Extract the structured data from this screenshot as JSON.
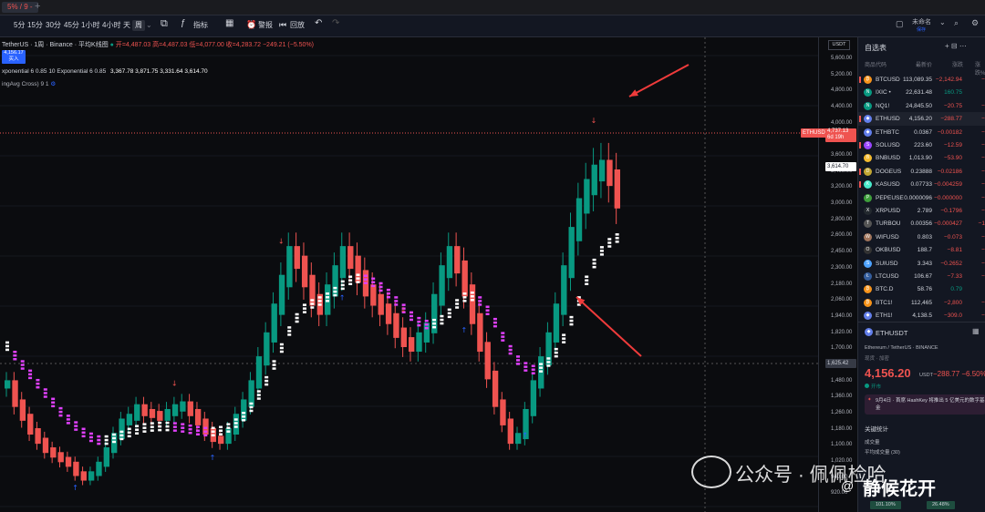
{
  "topbar": {
    "tab_label": "5% / 9 -",
    "plus": "+"
  },
  "toolbar": {
    "intervals": [
      "5分",
      "15分",
      "30分",
      "45分",
      "1小时",
      "4小时",
      "天",
      "周"
    ],
    "active_interval": "周",
    "indicators_label": "指标",
    "alert_label": "警报",
    "replay_label": "回放",
    "unnamed_label": "未命名",
    "save_sub": "保存"
  },
  "chart_header": {
    "symbol_line": "TetherUS · 1周 · Binance · 平均K线图",
    "ohlc": "开=4,487.03  高=4,487.03  低=4,077.00  收=4,283.72  −249.21 (−5.50%)",
    "price_box": "4,156.17",
    "price_box_sub": "买入",
    "indicator_line": "xponential 6 0.85 10 Exponential 6 0.85",
    "indicator_values": "3,367.78  3,871.75  3,331.64  3,614.70",
    "indicator2": "ingAvg Cross) 9 1"
  },
  "axis": {
    "unit": "USDT",
    "ticks": [
      "5,600.00",
      "5,200.00",
      "4,800.00",
      "4,400.00",
      "4,000.00",
      "3,800.00",
      "3,600.00",
      "3,400.00",
      "3,200.00",
      "3,000.00",
      "2,800.00",
      "2,600.00",
      "2,450.00",
      "2,300.00",
      "2,180.00",
      "2,060.00",
      "1,940.00",
      "1,820.00",
      "1,700.00",
      "1,580.00",
      "1,480.00",
      "1,360.00",
      "1,260.00",
      "1,180.00",
      "1,100.00",
      "1,020.00",
      "940.00",
      "920.00"
    ],
    "label_ethusdt": "ETHUSDT",
    "label_last": "4,737.13",
    "label_last_sub": "6d 19h",
    "label_ema": "3,614.70",
    "label_cross": "1,625.42"
  },
  "chart_data": {
    "type": "candlestick",
    "ylim": [
      900,
      5700
    ],
    "series": [
      {
        "name": "Heikin Ashi candles",
        "values": [
          2200,
          2000,
          1850,
          1700,
          1600,
          1500,
          1450,
          1400,
          1350,
          1250,
          1200,
          1250,
          1350,
          1500,
          1650,
          1800,
          1850,
          1950,
          1900,
          1880,
          1850,
          1900,
          1950,
          1980,
          1900,
          1800,
          1700,
          1620,
          1600,
          1700,
          1850,
          2000,
          2200,
          2450,
          2700,
          3000,
          3300,
          3600,
          3500,
          3300,
          3100,
          3000,
          3200,
          3400,
          3600,
          3500,
          3350,
          3200,
          3100,
          3000,
          2900,
          2750,
          2650,
          2600,
          2700,
          2800,
          3100,
          3400,
          3600,
          3450,
          3200,
          2900,
          2600,
          2300,
          2000,
          1800,
          1600,
          1650,
          1900,
          2200,
          2450,
          2700,
          3000,
          3400,
          3800,
          4100,
          4300,
          4450,
          4500,
          4400,
          4156
        ]
      },
      {
        "name": "EMA",
        "values": [
          2600,
          2500,
          2400,
          2300,
          2200,
          2100,
          2000,
          1900,
          1820,
          1750,
          1680,
          1630,
          1600,
          1600,
          1620,
          1650,
          1680,
          1710,
          1730,
          1740,
          1745,
          1745,
          1740,
          1730,
          1715,
          1700,
          1690,
          1690,
          1700,
          1730,
          1780,
          1850,
          1950,
          2080,
          2230,
          2400,
          2580,
          2760,
          2900,
          3000,
          3050,
          3080,
          3120,
          3180,
          3250,
          3300,
          3320,
          3310,
          3280,
          3230,
          3160,
          3080,
          3000,
          2920,
          2860,
          2830,
          2840,
          2880,
          2950,
          3050,
          3120,
          3130,
          3080,
          2980,
          2850,
          2700,
          2560,
          2450,
          2380,
          2350,
          2370,
          2430,
          2530,
          2680,
          2870,
          3080,
          3300,
          3480,
          3614,
          3700,
          3750
        ]
      }
    ]
  },
  "watchlist": {
    "title": "自选表",
    "icons": "+ ⊟ ⋯",
    "head": {
      "sym": "商品代码",
      "last": "最新价",
      "chg": "涨跌",
      "pct": "涨跌%"
    },
    "rows": [
      {
        "sym": "BTCUSD",
        "last": "113,089.35",
        "chg": "−2,142.94",
        "pct": "−1.8",
        "icon": "₿",
        "color": "#f7931a",
        "flag": true,
        "dir": "down"
      },
      {
        "sym": "IXIC •",
        "last": "22,631.48",
        "chg": "160.75",
        "pct": "0.7",
        "icon": "N",
        "color": "#089981",
        "flag": false,
        "dir": "up"
      },
      {
        "sym": "NQ1!",
        "last": "24,845.50",
        "chg": "−20.75",
        "pct": "−0.0",
        "icon": "N",
        "color": "#089981",
        "flag": false,
        "dir": "down"
      },
      {
        "sym": "ETHUSD",
        "last": "4,156.20",
        "chg": "−288.77",
        "pct": "−6.5",
        "icon": "◆",
        "color": "#627eea",
        "flag": true,
        "dir": "down"
      },
      {
        "sym": "ETHBTC",
        "last": "0.0367",
        "chg": "−0.00182",
        "pct": "−4.7",
        "icon": "◆",
        "color": "#627eea",
        "flag": false,
        "dir": "down"
      },
      {
        "sym": "SOLUSD",
        "last": "223.60",
        "chg": "−12.59",
        "pct": "−5.3",
        "icon": "S",
        "color": "#9945ff",
        "flag": true,
        "dir": "down"
      },
      {
        "sym": "BNBUSD",
        "last": "1,013.90",
        "chg": "−53.90",
        "pct": "−5.0",
        "icon": "B",
        "color": "#f3ba2f",
        "flag": false,
        "dir": "down"
      },
      {
        "sym": "DOGEUS",
        "last": "0.23888",
        "chg": "−0.02186",
        "pct": "−8.3",
        "icon": "D",
        "color": "#c2a633",
        "flag": true,
        "dir": "down"
      },
      {
        "sym": "KASUSD",
        "last": "0.07733",
        "chg": "−0.004259",
        "pct": "−5.2",
        "icon": "K",
        "color": "#49eacb",
        "flag": true,
        "dir": "down"
      },
      {
        "sym": "PEPEUSE",
        "last": "0.0000096",
        "chg": "−0.000000",
        "pct": "−7.4",
        "icon": "P",
        "color": "#3d9e3b",
        "flag": false,
        "dir": "down"
      },
      {
        "sym": "XRPUSD",
        "last": "2.789",
        "chg": "−0.1796",
        "pct": "−6.0",
        "icon": "X",
        "color": "#23292f",
        "flag": false,
        "dir": "down"
      },
      {
        "sym": "TURBOU",
        "last": "0.00356",
        "chg": "−0.000427",
        "pct": "−10.6",
        "icon": "T",
        "color": "#555",
        "flag": false,
        "dir": "down"
      },
      {
        "sym": "WIFUSD",
        "last": "0.803",
        "chg": "−0.073",
        "pct": "−8.3",
        "icon": "W",
        "color": "#a0745b",
        "flag": false,
        "dir": "down"
      },
      {
        "sym": "OKBUSD",
        "last": "188.7",
        "chg": "−8.81",
        "pct": "−4.4",
        "icon": "O",
        "color": "#333",
        "flag": false,
        "dir": "down"
      },
      {
        "sym": "SUIUSD",
        "last": "3.343",
        "chg": "−0.2652",
        "pct": "−7.3",
        "icon": "S",
        "color": "#4da2ff",
        "flag": false,
        "dir": "down"
      },
      {
        "sym": "LTCUSD",
        "last": "106.67",
        "chg": "−7.33",
        "pct": "−6.4",
        "icon": "Ł",
        "color": "#345d9d",
        "flag": false,
        "dir": "down"
      },
      {
        "sym": "BTC.D",
        "last": "58.76",
        "chg": "0.79",
        "pct": "1.3",
        "icon": "₿",
        "color": "#f7931a",
        "flag": false,
        "dir": "up"
      },
      {
        "sym": "BTC1!",
        "last": "112,465",
        "chg": "−2,800",
        "pct": "−2.4",
        "icon": "₿",
        "color": "#f7931a",
        "flag": false,
        "dir": "down"
      },
      {
        "sym": "ETH1!",
        "last": "4,138.5",
        "chg": "−309.0",
        "pct": "−6.9",
        "icon": "◆",
        "color": "#627eea",
        "flag": false,
        "dir": "down"
      }
    ]
  },
  "detail": {
    "symbol": "ETHUSDT",
    "sub": "Ethereum / TetherUS · BINANCE",
    "sub2": "现货 · 加密",
    "price": "4,156.20",
    "unit": "USDT",
    "change": "−288.77  −6.50%",
    "status": "开市",
    "news": "9月4日 · 首席 HashKey 将推出 5 亿美元的数字基金",
    "stats_title": "关键统计",
    "line1": "成交量",
    "line2": "平均成交量 (30)",
    "pill1": "101.10%",
    "pill2": "26.48%"
  },
  "watermark": {
    "text": "公众号 · 佩佩检哈",
    "text2": "静候花开",
    "at": "@"
  }
}
